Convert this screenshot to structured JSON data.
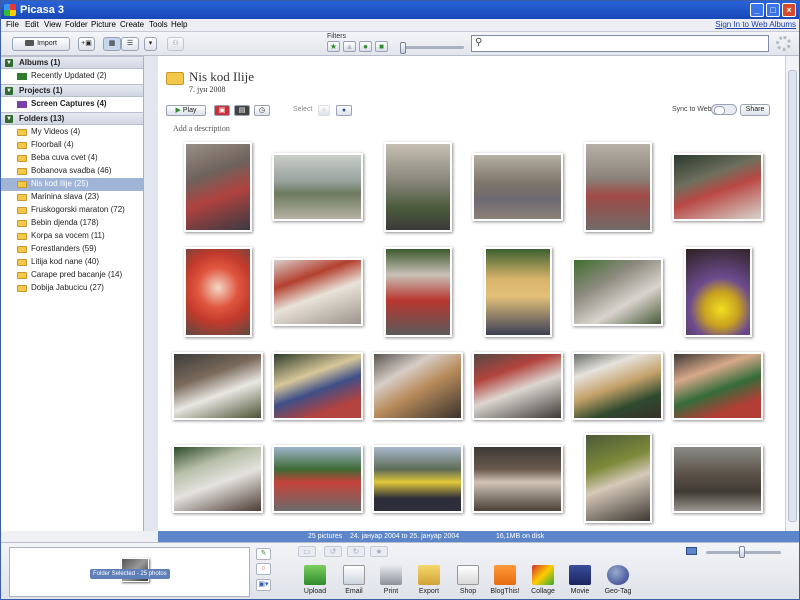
{
  "window": {
    "title": "Picasa 3"
  },
  "menu": {
    "items": [
      "File",
      "Edit",
      "View",
      "Folder",
      "Picture",
      "Create",
      "Tools",
      "Help"
    ],
    "signin": "Sign In to Web Albums"
  },
  "toolbar": {
    "import_label": "Import",
    "filters_label": "Filters",
    "search_value": ""
  },
  "sidebar": {
    "albums_header": "Albums (1)",
    "albums": [
      "Recently Updated (2)"
    ],
    "projects_header": "Projects (1)",
    "projects": [
      "Screen Captures (4)"
    ],
    "folders_header": "Folders (13)",
    "folders": [
      "My Videos (4)",
      "Floorball (4)",
      "Beba cuva cvet (4)",
      "Bobanova svadba (46)",
      "Nis kod Ilije (25)",
      "Marinina slava (23)",
      "Fruskogorski maraton (72)",
      "Bebin djenda (178)",
      "Korpa sa vocem (11)",
      "Forestlanders (59)",
      "Litija kod nane (40)",
      "Carape pred bacanje (14)",
      "Dobija Jabucicu (27)"
    ],
    "selected_folder": "Nis kod Ilije (25)"
  },
  "folder": {
    "title": "Nis kod Ilije",
    "date": "7. јун 2008",
    "description_placeholder": "Add a description"
  },
  "actions": {
    "play_label": "Play",
    "select_label": "Select",
    "sync_label": "Sync to Web",
    "share_label": "Share"
  },
  "status": {
    "count": "25 pictures",
    "range": "24. јануар 2004 to 25. јануар 2004",
    "size": "16,1MB on disk"
  },
  "tray": {
    "caption": "Folder Selected - 25 photos"
  },
  "bottom_buttons": [
    "Upload",
    "Email",
    "Print",
    "Export",
    "Shop",
    "BlogThis!",
    "Collage",
    "Movie",
    "Geo-Tag"
  ],
  "colors": {
    "accent": "#5c86c9",
    "selection": "#9fb4d6",
    "titlebar": "#1f55c8"
  }
}
